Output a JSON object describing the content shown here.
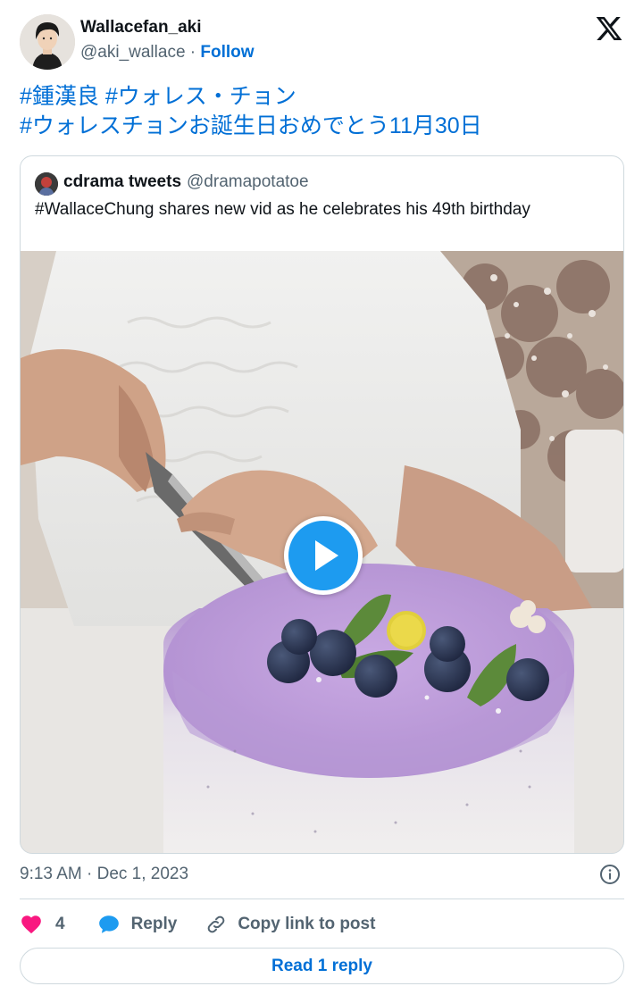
{
  "author": {
    "display_name": "Wallacefan_aki",
    "handle": "@aki_wallace",
    "separator": " · ",
    "follow_label": "Follow"
  },
  "tweet": {
    "text_lines": [
      "#鍾漢良 #ウォレス・チョン",
      "#ウォレスチョンお誕生日おめでとう11月30日"
    ]
  },
  "quoted": {
    "display_name": "cdrama tweets",
    "handle": "@dramapotatoe",
    "text": "#WallaceChung shares new vid as he celebrates his 49th birthday"
  },
  "meta": {
    "timestamp": "9:13 AM · Dec 1, 2023"
  },
  "actions": {
    "like_count": "4",
    "reply_label": "Reply",
    "copy_label": "Copy link to post",
    "read_replies_label": "Read 1 reply"
  },
  "icons": {
    "logo": "x-logo-icon",
    "play": "play-icon",
    "info": "info-icon",
    "like": "heart-icon",
    "reply": "speech-bubble-icon",
    "copy": "link-icon"
  },
  "colors": {
    "link_blue": "#006fd6",
    "accent_blue": "#1d9bf0",
    "like_red": "#f91880",
    "secondary_text": "#536471",
    "border": "#cfd9de"
  }
}
